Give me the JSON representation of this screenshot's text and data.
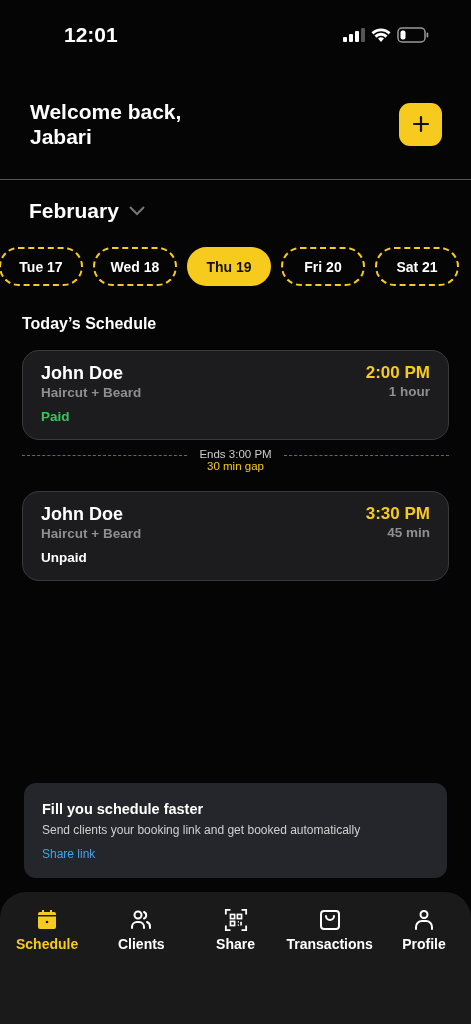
{
  "status_bar": {
    "time": "12:01"
  },
  "header": {
    "greeting": "Welcome back,",
    "name": "Jabari"
  },
  "month": "February",
  "days": [
    {
      "label": "Tue 17",
      "selected": false
    },
    {
      "label": "Wed 18",
      "selected": false
    },
    {
      "label": "Thu 19",
      "selected": true
    },
    {
      "label": "Fri 20",
      "selected": false
    },
    {
      "label": "Sat 21",
      "selected": false
    }
  ],
  "schedule_title": "Today’s Schedule",
  "appointments": [
    {
      "client": "John Doe",
      "service": "Haircut + Beard",
      "time": "2:00 PM",
      "duration": "1 hour",
      "payment": "Paid",
      "paid": true
    },
    {
      "client": "John Doe",
      "service": "Haircut + Beard",
      "time": "3:30 PM",
      "duration": "45 min",
      "payment": "Unpaid",
      "paid": false
    }
  ],
  "gaps": [
    {
      "ends": "Ends 3:00 PM",
      "gap": "30 min gap"
    }
  ],
  "banner": {
    "title": "Fill you schedule faster",
    "text": "Send clients your booking link and get booked automatically",
    "link": "Share link"
  },
  "nav": [
    {
      "kind": "calendar",
      "label": "Schedule",
      "selected": true
    },
    {
      "kind": "people",
      "label": "Clients",
      "selected": false
    },
    {
      "kind": "qr",
      "label": "Share",
      "selected": false
    },
    {
      "kind": "bag",
      "label": "Transactions",
      "selected": false
    },
    {
      "kind": "person",
      "label": "Profile",
      "selected": false
    }
  ]
}
